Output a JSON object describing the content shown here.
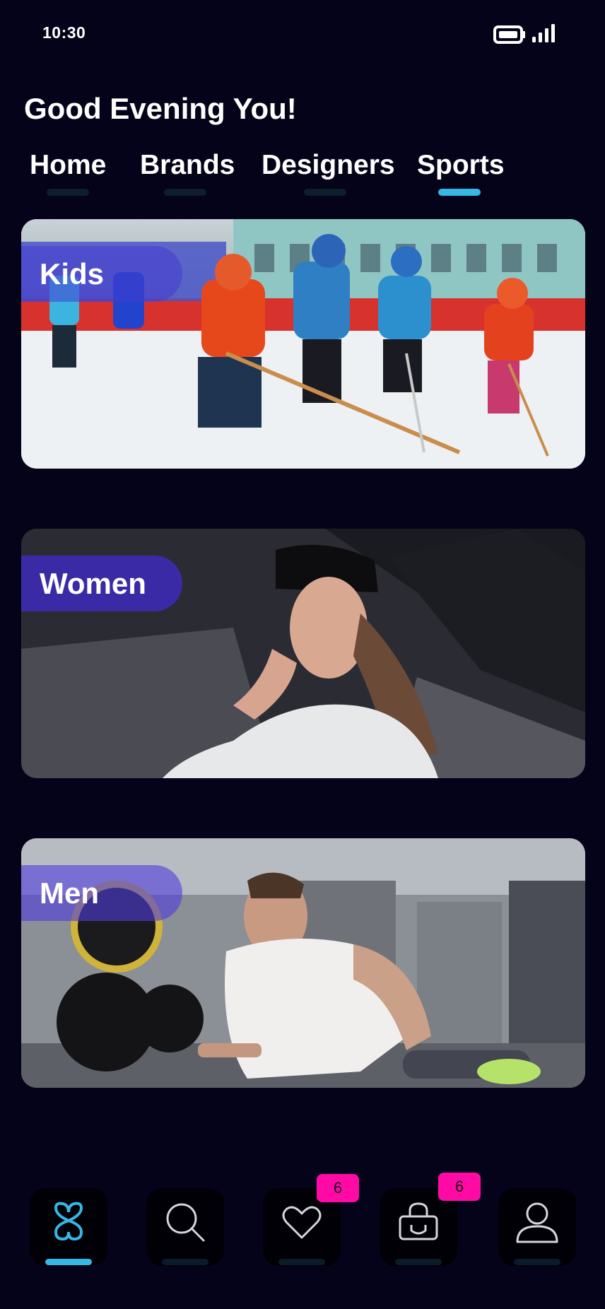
{
  "status_bar": {
    "time": "10:30"
  },
  "greeting": "Good Evening You!",
  "tabs": [
    {
      "label": "Home",
      "active": false
    },
    {
      "label": "Brands",
      "active": false
    },
    {
      "label": "Designers",
      "active": false
    },
    {
      "label": "Sports",
      "active": true
    }
  ],
  "categories": [
    {
      "label": "Kids",
      "image": "kids ice hockey photo"
    },
    {
      "label": "Women",
      "image": "woman in cap photo"
    },
    {
      "label": "Men",
      "image": "man doing push-ups in gym photo"
    }
  ],
  "bottom_nav": {
    "items": [
      {
        "icon": "logo-icon",
        "active": true
      },
      {
        "icon": "search-icon",
        "active": false
      },
      {
        "icon": "heart-icon",
        "active": false,
        "badge": "6"
      },
      {
        "icon": "shopping-bag-icon",
        "active": false,
        "badge": "6"
      },
      {
        "icon": "profile-icon",
        "active": false
      }
    ]
  },
  "colors": {
    "background": "#05031a",
    "accent": "#35b8e6",
    "badge": "#ff0aa5",
    "label_bg": "#3a2bb0"
  }
}
